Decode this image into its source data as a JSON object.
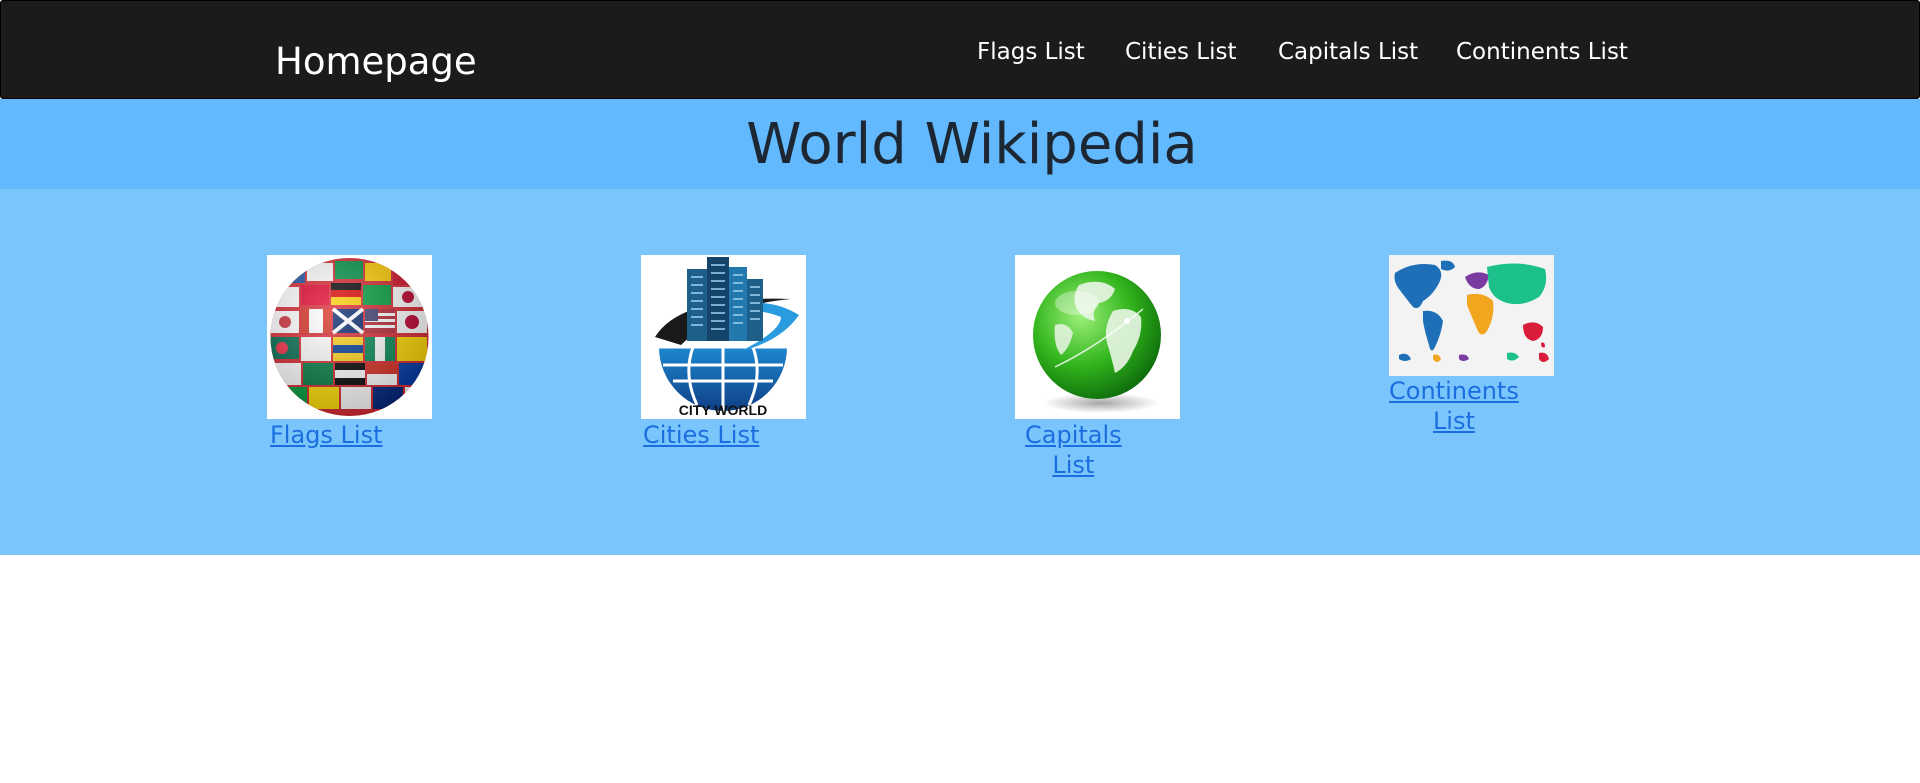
{
  "navbar": {
    "brand": "Homepage",
    "links": [
      {
        "label": "Flags List"
      },
      {
        "label": "Cities List"
      },
      {
        "label": "Capitals List"
      },
      {
        "label": "Continents List"
      }
    ]
  },
  "header": {
    "title": "World Wikipedia"
  },
  "tiles": [
    {
      "link_label": "Flags List",
      "image": "flag-globe-image"
    },
    {
      "link_label": "Cities List",
      "image": "city-world-logo",
      "image_caption": "CITY WORLD"
    },
    {
      "link_label_line1": "Capitals",
      "link_label_line2": "List",
      "image": "green-globe-image"
    },
    {
      "link_label_line1": "Continents",
      "link_label_line2": "List",
      "image": "world-continents-map"
    }
  ],
  "colors": {
    "navbar_bg": "#1c1b1c",
    "header_bg": "#62b9fd",
    "content_bg": "#7bc5fd",
    "link": "#1a6ee0",
    "title_text": "#1d2733"
  }
}
